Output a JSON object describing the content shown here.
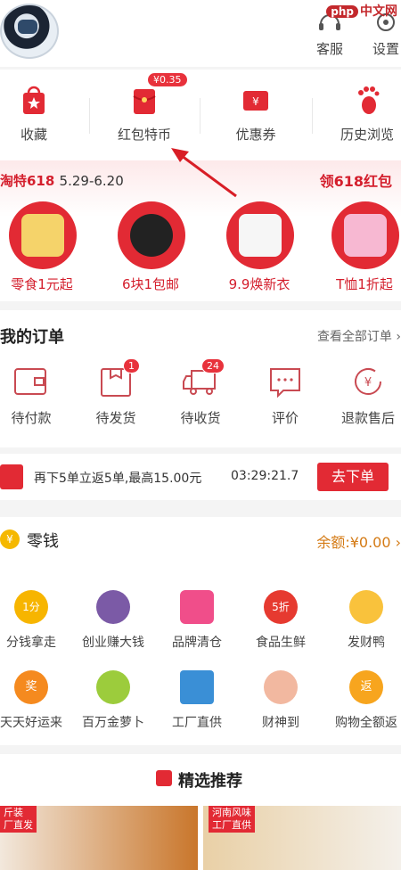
{
  "watermark": {
    "logo": "php",
    "text": "中文网"
  },
  "header": {
    "service_label": "客服",
    "settings_label": "设置"
  },
  "quick": {
    "items": [
      {
        "label": "收藏"
      },
      {
        "label": "红包特币"
      },
      {
        "label": "优惠券"
      },
      {
        "label": "历史浏览"
      }
    ],
    "coin_badge": "¥0.35"
  },
  "promo": {
    "left_text": "淘特618",
    "dates": "5.29-6.20",
    "right_text": "领618红包",
    "items": [
      {
        "label": "零食1元起"
      },
      {
        "label": "6块1包邮"
      },
      {
        "label": "9.9焕新衣"
      },
      {
        "label": "T恤1折起"
      }
    ]
  },
  "orders": {
    "title": "我的订单",
    "view_all": "查看全部订单",
    "items": [
      {
        "label": "待付款"
      },
      {
        "label": "待发货",
        "count": "1"
      },
      {
        "label": "待收货",
        "count": "24"
      },
      {
        "label": "评价"
      },
      {
        "label": "退款售后"
      }
    ]
  },
  "rebate": {
    "text": "再下5单立返5单,最高15.00元",
    "timer": "03:29:21.7",
    "button": "去下单"
  },
  "wallet": {
    "coin_char": "¥",
    "title": "零钱",
    "balance": "余额:¥0.00"
  },
  "grid": {
    "row1": [
      "分钱拿走",
      "创业赚大钱",
      "品牌清仓",
      "食品生鲜",
      "发财鸭"
    ],
    "row2": [
      "天天好运来",
      "百万金萝卜",
      "工厂直供",
      "财神到",
      "购物全额返"
    ],
    "icon_texts": {
      "fen": "1分",
      "discount": "5折",
      "lucky": "奖",
      "fan": "返"
    }
  },
  "featured": {
    "title": "精选推荐",
    "card1_tag": "斤装\n厂直发",
    "card2_tag": "河南风味\n工厂直供"
  },
  "colors": {
    "brand": "#e22a34",
    "accent": "#d41f2d",
    "gold": "#d47a14"
  }
}
